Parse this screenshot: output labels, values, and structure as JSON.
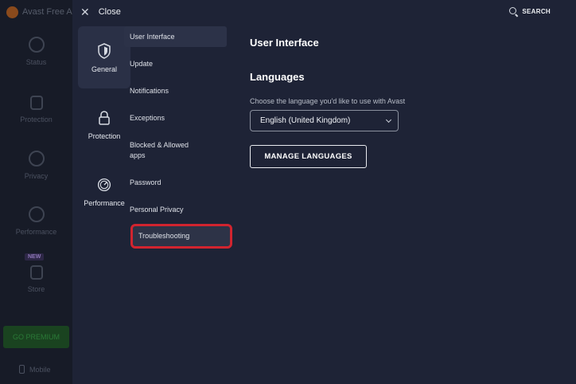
{
  "app": {
    "title": "Avast Free A",
    "nav": [
      {
        "label": "Status",
        "icon": "check-circle-icon"
      },
      {
        "label": "Protection",
        "icon": "lock-icon"
      },
      {
        "label": "Privacy",
        "icon": "fingerprint-icon"
      },
      {
        "label": "Performance",
        "icon": "speedometer-icon"
      },
      {
        "label": "Store",
        "icon": "cart-icon"
      }
    ],
    "new_badge": "NEW",
    "premium_label": "GO PREMIUM",
    "mobile_label": "Mobile"
  },
  "header": {
    "close_label": "Close",
    "search_label": "SEARCH"
  },
  "categories": [
    {
      "label": "General",
      "icon": "shield-icon",
      "active": true
    },
    {
      "label": "Protection",
      "icon": "lock-icon",
      "active": false
    },
    {
      "label": "Performance",
      "icon": "speedometer-icon",
      "active": false
    }
  ],
  "menu": [
    {
      "label": "User Interface",
      "state": "active"
    },
    {
      "label": "Update",
      "state": "normal"
    },
    {
      "label": "Notifications",
      "state": "normal"
    },
    {
      "label": "Exceptions",
      "state": "normal"
    },
    {
      "label": "Blocked & Allowed apps",
      "state": "normal"
    },
    {
      "label": "Password",
      "state": "normal"
    },
    {
      "label": "Personal Privacy",
      "state": "normal"
    },
    {
      "label": "Troubleshooting",
      "state": "highlighted"
    }
  ],
  "content": {
    "title": "User Interface",
    "languages_title": "Languages",
    "languages_desc": "Choose the language you'd like to use with Avast",
    "language_value": "English (United Kingdom)",
    "manage_button": "MANAGE LANGUAGES"
  },
  "colors": {
    "background": "#1e2336",
    "sidebar": "#171b27",
    "highlight_border": "#d1242f",
    "premium": "#1a4320"
  }
}
